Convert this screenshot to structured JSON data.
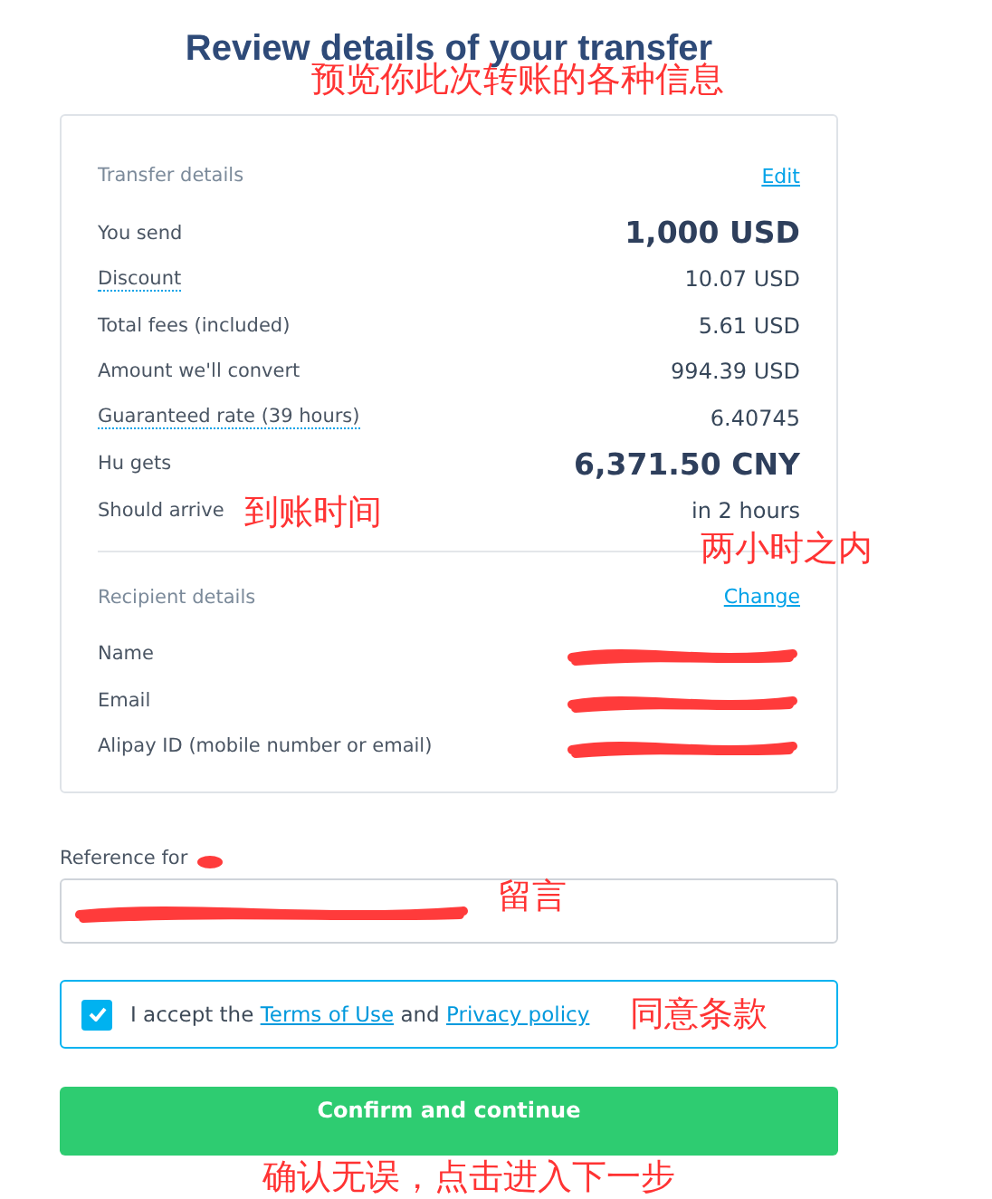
{
  "title": "Review details of your transfer",
  "transfer_details": {
    "heading": "Transfer details",
    "action": "Edit",
    "rows": [
      {
        "label": "You send",
        "value": "1,000 USD",
        "emphasis": true,
        "info": false
      },
      {
        "label": "Discount",
        "value": "10.07 USD",
        "emphasis": false,
        "info": true
      },
      {
        "label": "Total fees (included)",
        "value": "5.61 USD",
        "emphasis": false,
        "info": false
      },
      {
        "label": "Amount we'll convert",
        "value": "994.39 USD",
        "emphasis": false,
        "info": false
      },
      {
        "label": "Guaranteed rate (39 hours)",
        "value": "6.40745",
        "emphasis": false,
        "info": true
      },
      {
        "label": "Hu gets",
        "value": "6,371.50 CNY",
        "emphasis": true,
        "info": false
      },
      {
        "label": "Should arrive",
        "value": "in 2 hours",
        "emphasis": false,
        "info": false
      }
    ]
  },
  "recipient_details": {
    "heading": "Recipient details",
    "action": "Change",
    "rows": [
      {
        "label": "Name",
        "redacted": true
      },
      {
        "label": "Email",
        "redacted": true
      },
      {
        "label": "Alipay ID (mobile number or email)",
        "redacted": true
      }
    ]
  },
  "reference": {
    "label": "Reference for",
    "redacted": true
  },
  "terms": {
    "checked": true,
    "before": "I accept the",
    "link_1": "Terms of Use",
    "middle": "and",
    "link_2": "Privacy policy"
  },
  "confirm_button": "Confirm and continue",
  "annotations": [
    {
      "text": "预览你此次转账的各种信息"
    },
    {
      "text": "到账时间"
    },
    {
      "text": "两小时之内"
    },
    {
      "text": "留言"
    },
    {
      "text": "同意条款"
    },
    {
      "text": "确认无误，点击进入下一步"
    }
  ]
}
